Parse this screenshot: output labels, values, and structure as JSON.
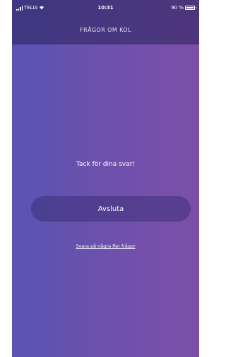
{
  "status_bar": {
    "carrier": "TELIA",
    "time": "10:31",
    "battery": "90 %",
    "icons": [
      "signal-icon",
      "wifi-icon",
      "battery-icon"
    ]
  },
  "header": {
    "title": "FRÅGOR OM KOL"
  },
  "main": {
    "thanks_text": "Tack för dina svar!",
    "finish_button_label": "Avsluta",
    "more_questions_link": "Svara på några fler frågor"
  },
  "colors": {
    "gradient_left": "#5a53b3",
    "gradient_right": "#7c4fa8",
    "bar_overlay": "#28205a"
  }
}
